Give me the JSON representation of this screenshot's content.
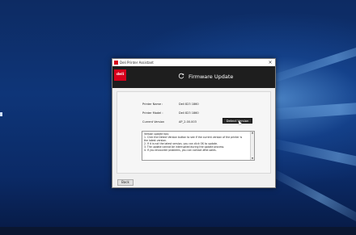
{
  "window": {
    "title": "Deli Printer Assistant",
    "close_glyph": "×"
  },
  "header": {
    "logo_text": "deli",
    "title": "Firmware Update",
    "icon": "refresh-icon"
  },
  "printer_info": {
    "rows": [
      {
        "label": "Printer Name :",
        "value": "Deli 823 1860"
      },
      {
        "label": "Printer Model :",
        "value": "Deli 823 1860"
      },
      {
        "label": "Current Version",
        "value": "AP_2.00.003"
      }
    ]
  },
  "actions": {
    "detect_label": "Detect Version",
    "back_label": "Back"
  },
  "tips": {
    "lines": [
      "Version update tips:",
      "1. Click the Detect Version button to see if the current version of the printer is",
      "the latest version.",
      "2. If it is not the latest version, you can click OK to update.",
      "3. The update cannot be interrupted during the update process.",
      "4. If you encounter problems, you can contact after-sales."
    ]
  },
  "colors": {
    "brand": "#d6001c",
    "header_bg": "#1e1e1e",
    "desktop": "#0e3578"
  }
}
